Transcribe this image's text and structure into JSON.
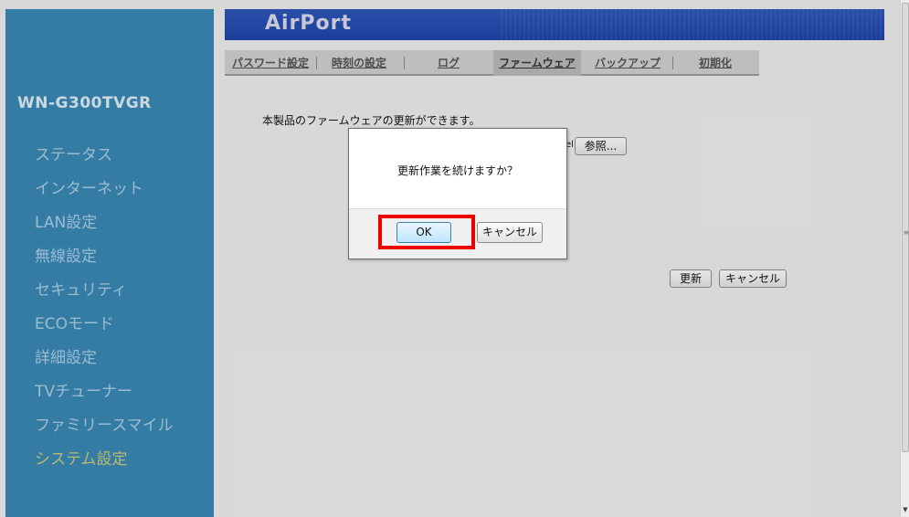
{
  "header": {
    "brand": "AirPort"
  },
  "sidebar": {
    "model": "WN-G300TVGR",
    "items": [
      {
        "label": "ステータス"
      },
      {
        "label": "インターネット"
      },
      {
        "label": "LAN設定"
      },
      {
        "label": "無線設定"
      },
      {
        "label": "セキュリティ"
      },
      {
        "label": "ECOモード"
      },
      {
        "label": "詳細設定"
      },
      {
        "label": "TVチューナー"
      },
      {
        "label": "ファミリースマイル"
      },
      {
        "label": "システム設定"
      }
    ],
    "active_item": "システム設定"
  },
  "tabs": [
    {
      "label": "パスワード設定"
    },
    {
      "label": "時刻の設定"
    },
    {
      "label": "ログ"
    },
    {
      "label": "ファームウェア"
    },
    {
      "label": "バックアップ"
    },
    {
      "label": "初期化"
    }
  ],
  "active_tab": "ファームウェア",
  "main": {
    "description": "本製品のファームウェアの更新ができます。",
    "file_input_tail": "el",
    "browse_label": "参照...",
    "update_label": "更新",
    "cancel_label": "キャンセル"
  },
  "dialog": {
    "message": "更新作業を続けますか？",
    "ok_label": "OK",
    "cancel_label": "キャンセル"
  },
  "colors": {
    "sidebar": "#3a87b4",
    "banner": "#1f44a8",
    "highlight": "#ee0000",
    "active_nav": "#c9c978"
  }
}
